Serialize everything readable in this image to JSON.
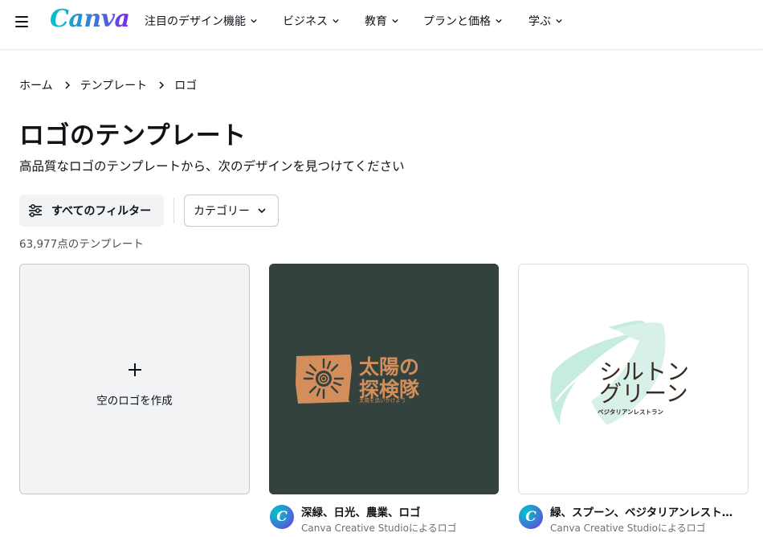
{
  "header": {
    "logo": "Canva",
    "nav": [
      {
        "label": "注目のデザイン機能"
      },
      {
        "label": "ビジネス"
      },
      {
        "label": "教育"
      },
      {
        "label": "プランと価格"
      },
      {
        "label": "学ぶ"
      }
    ]
  },
  "breadcrumb": [
    "ホーム",
    "テンプレート",
    "ロゴ"
  ],
  "page": {
    "title": "ロゴのテンプレート",
    "subtitle": "高品質なロゴのテンプレートから、次のデザインを見つけてください"
  },
  "filters": {
    "all_filters": "すべてのフィルター",
    "category": "カテゴリー"
  },
  "result_count": "63,977点のテンプレート",
  "blank_card": {
    "label": "空のロゴを作成"
  },
  "templates": [
    {
      "title": "深緑、日光、農業、ロゴ",
      "author": "Canva Creative Studioによるロゴ",
      "logo_text_line1": "太陽の",
      "logo_text_line2": "探検隊",
      "logo_tagline": "太陽を追いかけよう",
      "bg_color": "#33423d",
      "accent_color": "#d38e5c"
    },
    {
      "title": "緑、スプーン、ベジタリアンレストラン、ロゴ",
      "author": "Canva Creative Studioによるロゴ",
      "logo_text_line1": "シルトン",
      "logo_text_line2": "グリーン",
      "logo_tagline": "ベジタリアンレストラン",
      "text_color": "#3b2c22",
      "leaf_color": "#c6ebe0"
    }
  ],
  "avatar_letter": "C"
}
